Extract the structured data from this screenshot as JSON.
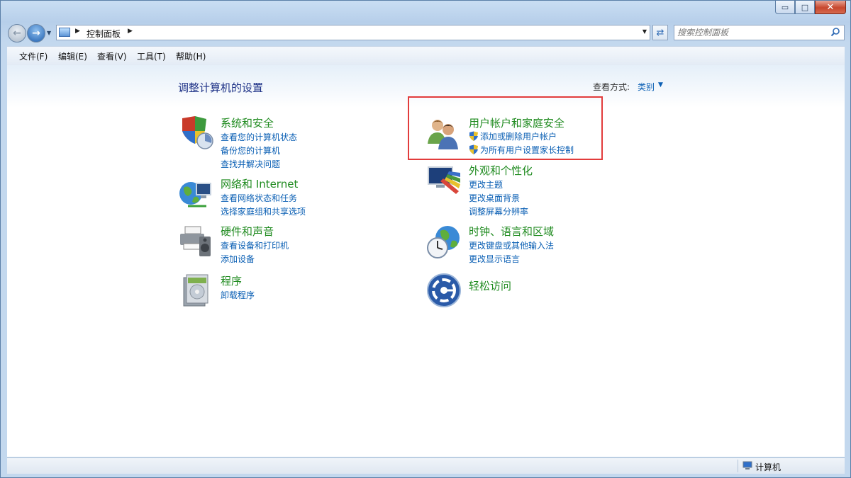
{
  "window": {
    "minimize_glyph": "▭",
    "maximize_glyph": "□",
    "close_glyph": "✕"
  },
  "nav": {
    "back_glyph": "←",
    "forward_glyph": "→",
    "address_path": "控制面板",
    "search_placeholder": "搜索控制面板"
  },
  "menu": {
    "items": [
      "文件(F)",
      "编辑(E)",
      "查看(V)",
      "工具(T)",
      "帮助(H)"
    ]
  },
  "main": {
    "title": "调整计算机的设置",
    "view_by_label": "查看方式:",
    "view_by_value": "类别"
  },
  "categories": [
    {
      "title": "系统和安全",
      "icon": "system-security-icon",
      "links": [
        "查看您的计算机状态",
        "备份您的计算机",
        "查找并解决问题"
      ]
    },
    {
      "title": "网络和 Internet",
      "icon": "network-internet-icon",
      "links": [
        "查看网络状态和任务",
        "选择家庭组和共享选项"
      ]
    },
    {
      "title": "硬件和声音",
      "icon": "hardware-sound-icon",
      "links": [
        "查看设备和打印机",
        "添加设备"
      ]
    },
    {
      "title": "程序",
      "icon": "programs-icon",
      "links": [
        "卸载程序"
      ]
    },
    {
      "title": "用户帐户和家庭安全",
      "icon": "user-accounts-icon",
      "links": [
        "添加或删除用户帐户",
        "为所有用户设置家长控制"
      ]
    },
    {
      "title": "外观和个性化",
      "icon": "appearance-icon",
      "links": [
        "更改主题",
        "更改桌面背景",
        "调整屏幕分辨率"
      ]
    },
    {
      "title": "时钟、语言和区域",
      "icon": "clock-language-icon",
      "links": [
        "更改键盘或其他输入法",
        "更改显示语言"
      ]
    },
    {
      "title": "轻松访问",
      "icon": "ease-of-access-icon",
      "links": []
    }
  ],
  "status": {
    "text": "计算机"
  },
  "colors": {
    "category_title": "#1e8a1e",
    "link": "#0a5fb4",
    "highlight_border": "#e23c3c"
  }
}
